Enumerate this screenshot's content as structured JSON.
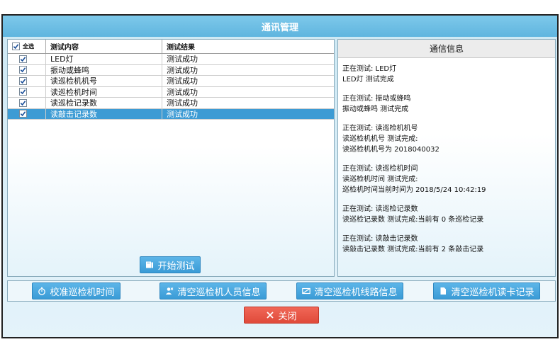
{
  "window": {
    "title": "通讯管理"
  },
  "grid": {
    "select_all_label": "全选",
    "col_content": "测试内容",
    "col_result": "测试结果",
    "rows": [
      {
        "content": "LED灯",
        "result": "测试成功"
      },
      {
        "content": "振动或蜂鸣",
        "result": "测试成功"
      },
      {
        "content": "读巡检机机号",
        "result": "测试成功"
      },
      {
        "content": "读巡检机时间",
        "result": "测试成功"
      },
      {
        "content": "读巡检记录数",
        "result": "测试成功"
      },
      {
        "content": "读敲击记录数",
        "result": "测试成功"
      }
    ]
  },
  "buttons": {
    "start": "开始测试",
    "sync_time": "校准巡检机时间",
    "clear_staff": "清空巡检机人员信息",
    "clear_route": "清空巡检机线路信息",
    "clear_cards": "清空巡检机读卡记录",
    "close": "关闭"
  },
  "info": {
    "title": "通信信息",
    "log": [
      [
        "正在测试: LED灯",
        "LED灯 测试完成"
      ],
      [
        "正在测试: 振动或蜂鸣",
        "振动或蜂鸣 测试完成"
      ],
      [
        "正在测试: 读巡检机机号",
        "读巡检机机号 测试完成:",
        "读巡检机机号为 2018040032"
      ],
      [
        "正在测试: 读巡检机时间",
        "读巡检机时间 测试完成:",
        "巡检机时间当前时间为 2018/5/24 10:42:19"
      ],
      [
        "正在测试: 读巡检记录数",
        "读巡检记录数 测试完成:当前有 0 条巡检记录"
      ],
      [
        "正在测试: 读敲击记录数",
        "读敲击记录数 测试完成:当前有 2 条敲击记录"
      ]
    ]
  },
  "colors": {
    "accent": "#3a9bd6",
    "title_bar": "#6cbfe6",
    "selected_row": "#3d9bd4",
    "close_button": "#e04a3a"
  }
}
